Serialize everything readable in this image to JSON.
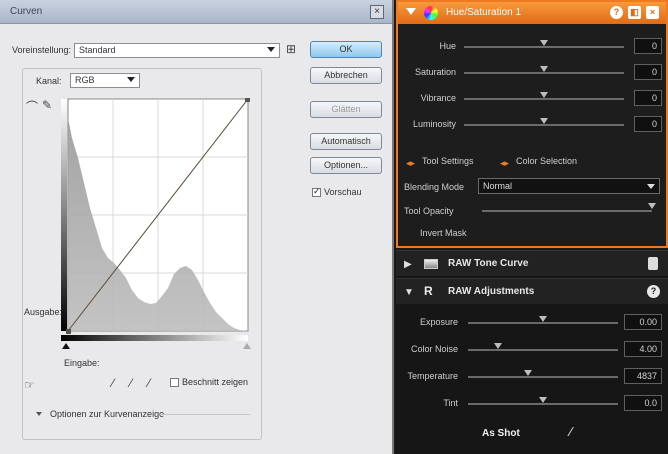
{
  "curves_dialog": {
    "title": "Curven",
    "preset_label": "Voreinstellung:",
    "preset_value": "Standard",
    "channel_label": "Kanal:",
    "channel_value": "RGB",
    "output_label": "Ausgabe:",
    "input_label": "Eingabe:",
    "show_clipping_label": "Beschnitt zeigen",
    "curve_options_label": "Optionen zur Kurvenanzeige",
    "buttons": {
      "ok": "OK",
      "cancel": "Abbrechen",
      "smooth": "Glätten",
      "auto": "Automatisch",
      "options": "Optionen...",
      "preview": "Vorschau"
    },
    "preview_checked": true
  },
  "hue_saturation": {
    "title": "Hue/Saturation 1",
    "sliders": [
      {
        "label": "Hue",
        "value": "0",
        "pos": 0.5
      },
      {
        "label": "Saturation",
        "value": "0",
        "pos": 0.5
      },
      {
        "label": "Vibrance",
        "value": "0",
        "pos": 0.5
      },
      {
        "label": "Luminosity",
        "value": "0",
        "pos": 0.5
      }
    ],
    "tool_settings_label": "Tool Settings",
    "color_selection_label": "Color Selection",
    "blending_mode_label": "Blending Mode",
    "blending_mode_value": "Normal",
    "tool_opacity_label": "Tool Opacity",
    "tool_opacity_pos": 1.0,
    "invert_mask_label": "Invert Mask"
  },
  "raw_tone_curve": {
    "title": "RAW Tone Curve"
  },
  "raw_adjustments": {
    "title": "RAW Adjustments",
    "sliders": [
      {
        "label": "Exposure",
        "value": "0.00",
        "pos": 0.5
      },
      {
        "label": "Color Noise",
        "value": "4.00",
        "pos": 0.2
      },
      {
        "label": "Temperature",
        "value": "4837",
        "pos": 0.4
      },
      {
        "label": "Tint",
        "value": "0.0",
        "pos": 0.5
      }
    ],
    "as_shot_label": "As Shot"
  },
  "colors": {
    "accent": "#f07a22",
    "dark_bg": "#1d1d1d",
    "dialog_bg": "#e9e9ec"
  }
}
